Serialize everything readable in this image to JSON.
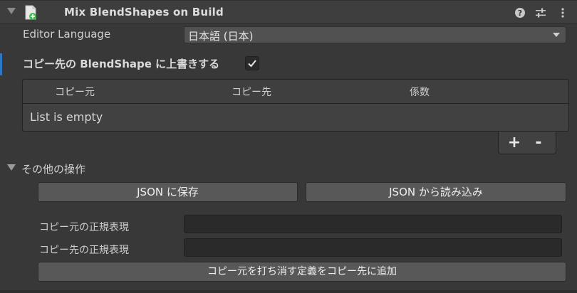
{
  "header": {
    "title": "Mix BlendShapes on Build",
    "icons": [
      "foldout-arrow",
      "component-script-icon",
      "help-icon",
      "preset-sliders-icon",
      "kebab-menu-icon"
    ]
  },
  "editor_language": {
    "label": "Editor Language",
    "value": "日本語 (日本)"
  },
  "overwrite": {
    "label": "コピー先の BlendShape に上書きする",
    "checked": true
  },
  "list": {
    "columns": [
      "コピー元",
      "コピー先",
      "係数"
    ],
    "empty_text": "List is empty",
    "add_label": "+",
    "remove_label": "-"
  },
  "other_ops": {
    "label": "その他の操作",
    "save_json_label": "JSON に保存",
    "load_json_label": "JSON から読み込み",
    "source_regex_label": "コピー元の正規表現",
    "source_regex_value": "",
    "dest_regex_label": "コピー先の正規表現",
    "dest_regex_value": "",
    "add_cancel_label": "コピー元を打ち消す定義をコピー先に追加"
  },
  "colors": {
    "accent": "#2d78c4",
    "icon_green": "#3fbf4f"
  }
}
